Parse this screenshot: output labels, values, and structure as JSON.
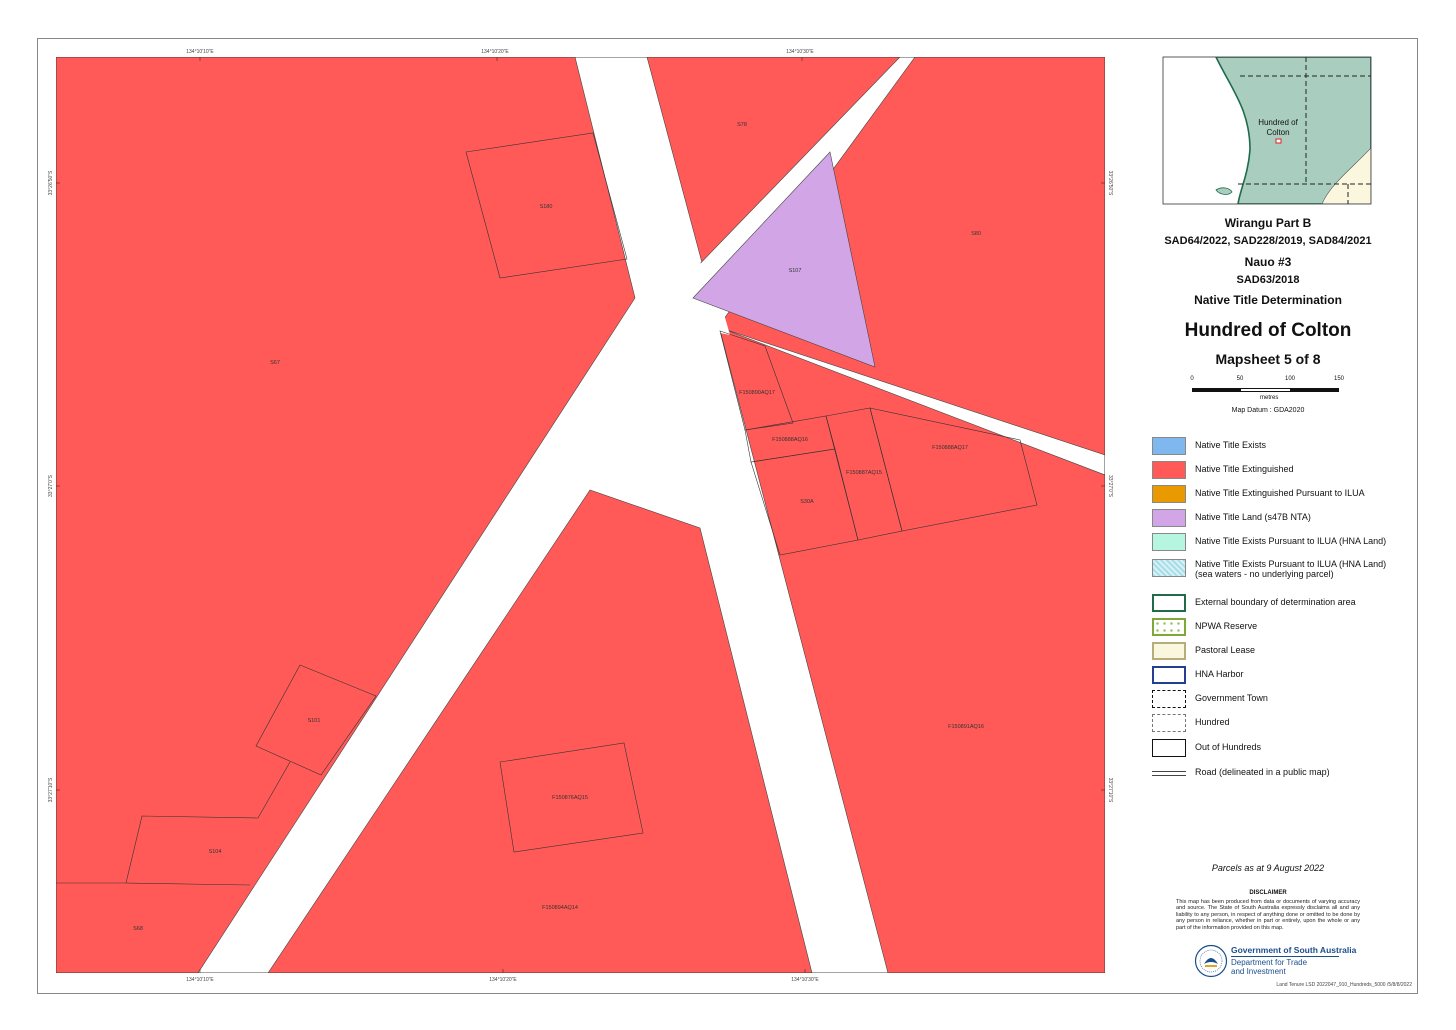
{
  "title_block": {
    "claim1_name": "Wirangu Part B",
    "claim1_numbers": "SAD64/2022, SAD228/2019, SAD84/2021",
    "claim2_name": "Nauo #3",
    "claim2_number": "SAD63/2018",
    "determination": "Native Title Determination",
    "hundred_name": "Hundred of Colton",
    "mapsheet": "Mapsheet 5 of 8",
    "map_datum": "Map Datum : GDA2020"
  },
  "scale_bar": {
    "ticks": [
      "0",
      "50",
      "100",
      "150"
    ],
    "unit": "metres"
  },
  "inset": {
    "label_line1": "Hundred of",
    "label_line2": "Colton"
  },
  "legend": [
    {
      "label": "Native Title Exists",
      "color": "#7fb8ee"
    },
    {
      "label": "Native Title Extinguished",
      "color": "#ff5a58"
    },
    {
      "label": "Native Title Extinguished Pursuant to ILUA",
      "color": "#e89a00"
    },
    {
      "label": "Native Title Land (s47B NTA)",
      "color": "#d2a6e6"
    },
    {
      "label": "Native Title Exists Pursuant to ILUA (HNA Land)",
      "color": "#b6f6e0"
    },
    {
      "label": "Native Title Exists Pursuant to ILUA (HNA Land)",
      "label2": "(sea waters - no underlying parcel)",
      "color": "#a8dde8"
    },
    {
      "label": "External boundary of determination area",
      "color": "#ffffff"
    },
    {
      "label": "NPWA Reserve",
      "color": "#ffffff"
    },
    {
      "label": "Pastoral Lease",
      "color": "#ffffff"
    },
    {
      "label": "HNA Harbor",
      "color": "#ffffff"
    },
    {
      "label": "Government Town",
      "color": "#ffffff"
    },
    {
      "label": "Hundred",
      "color": "#ffffff"
    },
    {
      "label": "Out of Hundreds",
      "color": "#ffffff"
    },
    {
      "label": "Road (delineated in a public map)",
      "color": "#ffffff"
    }
  ],
  "parcel_labels": {
    "s78": "S78",
    "s180": "S180",
    "s80": "S80",
    "s107": "S107",
    "s67": "S67",
    "f_a": "F150890AQ17",
    "f_b": "F150888AQ16",
    "f_c": "F150887AQ15",
    "f_d": "F150888AQ17",
    "s30a": "S30A",
    "f_e": "F150891AQ16",
    "s101": "S101",
    "f_f": "F150876AQ15",
    "s104": "S104",
    "f_g": "F150894AQ14",
    "s68": "S68"
  },
  "coords": {
    "top1": "134°10'10\"E",
    "top2": "134°10'20\"E",
    "top3": "134°10'30\"E",
    "bot1": "134°10'10\"E",
    "bot2": "134°10'20\"E",
    "bot3": "134°10'30\"E",
    "left1": "33°26'50\"S",
    "left2": "33°27'0\"S",
    "left3": "33°27'10\"S",
    "right1": "33°26'50\"S",
    "right2": "33°27'0\"S",
    "right3": "33°27'10\"S"
  },
  "footer": {
    "parcels_date": "Parcels as at 9 August 2022",
    "disclaimer_title": "DISCLAIMER",
    "disclaimer_body": "This map has been produced from data or documents of varying accuracy and source. The State of South Australia expressly disclaims all and any liability to any person, in respect of anything done or omitted to be done by any person in reliance, whether in part or entirely, upon the whole or any part of the information provided on this map.",
    "gov_name": "Government of South Australia",
    "dept_line1": "Department for Trade",
    "dept_line2": "and Investment",
    "file_ref": "Land Tenure LSD 2022047_910_Hundreds_5000 /5/8/8/2022"
  },
  "colors": {
    "extinguished": "#ff5a58",
    "s47b": "#d2a6e6",
    "inset_land": "#a9cdbf",
    "inset_pastoral": "#fbf7df",
    "boundary_green": "#1f6b4a"
  }
}
